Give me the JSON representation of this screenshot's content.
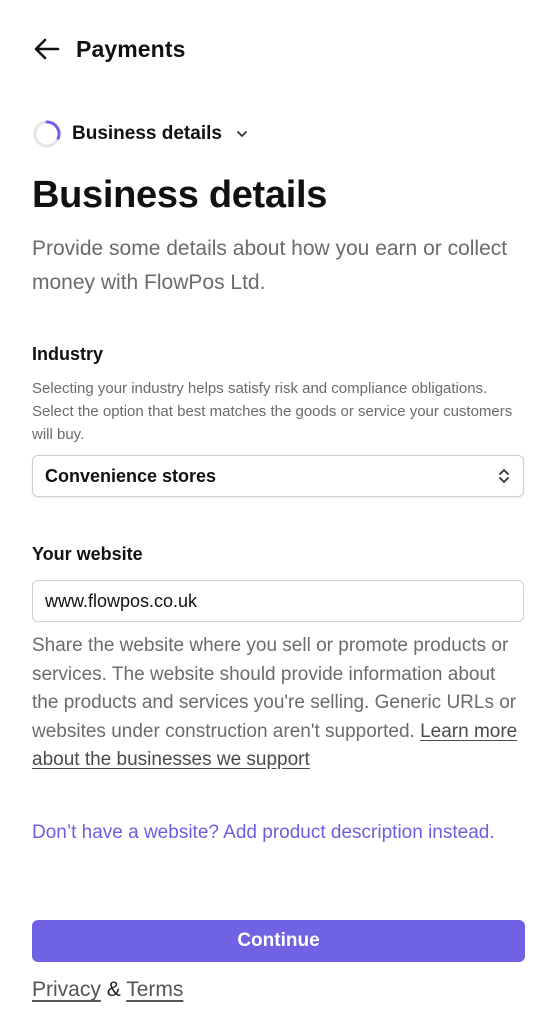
{
  "header": {
    "title": "Payments",
    "back_icon": "arrow-left-icon"
  },
  "step": {
    "label": "Business details",
    "progress_icon": "progress-ring-icon",
    "accent": "#6f63e3"
  },
  "page": {
    "title": "Business details",
    "subtitle": "Provide some details about how you earn or collect money with FlowPos Ltd."
  },
  "industry": {
    "label": "Industry",
    "help": "Selecting your industry helps satisfy risk and compliance obligations. Select the option that best matches the goods or service your customers will buy.",
    "selected": "Convenience stores"
  },
  "website": {
    "label": "Your website",
    "value": "www.flowpos.co.uk",
    "help": "Share the website where you sell or promote products or services. The website should provide information about the products and services you're selling. Generic URLs or websites under construction aren't supported.",
    "learn_more": "Learn more about the businesses we support",
    "alt_link": "Don’t have a website? Add product description instead."
  },
  "actions": {
    "continue": "Continue",
    "continue_color": "#6f63e3"
  },
  "footer": {
    "privacy": "Privacy",
    "amp": "&",
    "terms": "Terms"
  }
}
